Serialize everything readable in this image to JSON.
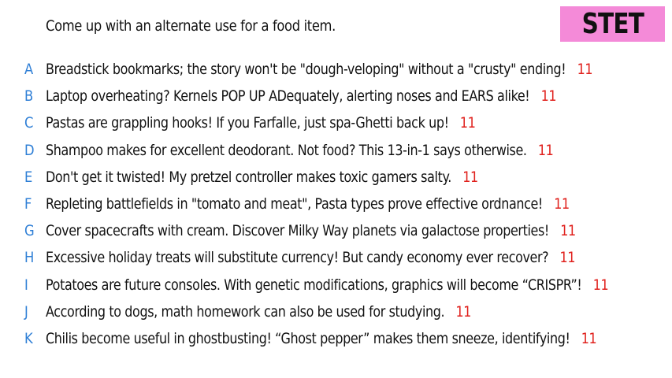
{
  "prompt": "Come up with an alternate use for a food item.",
  "logo": {
    "text": "STET",
    "color": "#f48ad8"
  },
  "colors": {
    "letter": "#2f7fd6",
    "score": "#e0201c",
    "text": "#111111"
  },
  "answers": [
    {
      "letter": "A",
      "text": "Breadstick bookmarks; the story won't be \"dough-veloping\" without a \"crusty\" ending!",
      "score": "11"
    },
    {
      "letter": "B",
      "text": "Laptop overheating? Kernels POP UP ADequately, alerting noses and EARS alike!",
      "score": "11"
    },
    {
      "letter": "C",
      "text": "Pastas are grappling hooks! If you Farfalle, just spa-Ghetti back up!",
      "score": "11"
    },
    {
      "letter": "D",
      "text": "Shampoo makes for excellent deodorant. Not food? This 13-in-1 says otherwise.",
      "score": "11"
    },
    {
      "letter": "E",
      "text": "Don't get it twisted! My pretzel controller makes toxic gamers salty.",
      "score": "11"
    },
    {
      "letter": "F",
      "text": "Repleting battlefields in \"tomato and meat\", Pasta types prove effective ordnance!",
      "score": "11"
    },
    {
      "letter": "G",
      "text": "Cover spacecrafts with cream. Discover Milky Way planets via galactose properties!",
      "score": "11"
    },
    {
      "letter": "H",
      "text": "Excessive holiday treats will substitute currency! But candy economy ever recover?",
      "score": "11"
    },
    {
      "letter": "I",
      "text": "Potatoes are future consoles. With genetic modifications, graphics will become “CRISPR”!",
      "score": "11"
    },
    {
      "letter": "J",
      "text": "According to dogs, math homework can also be used for studying.",
      "score": "11"
    },
    {
      "letter": "K",
      "text": "Chilis become useful in ghostbusting! “Ghost pepper” makes them sneeze, identifying!",
      "score": "11"
    }
  ]
}
